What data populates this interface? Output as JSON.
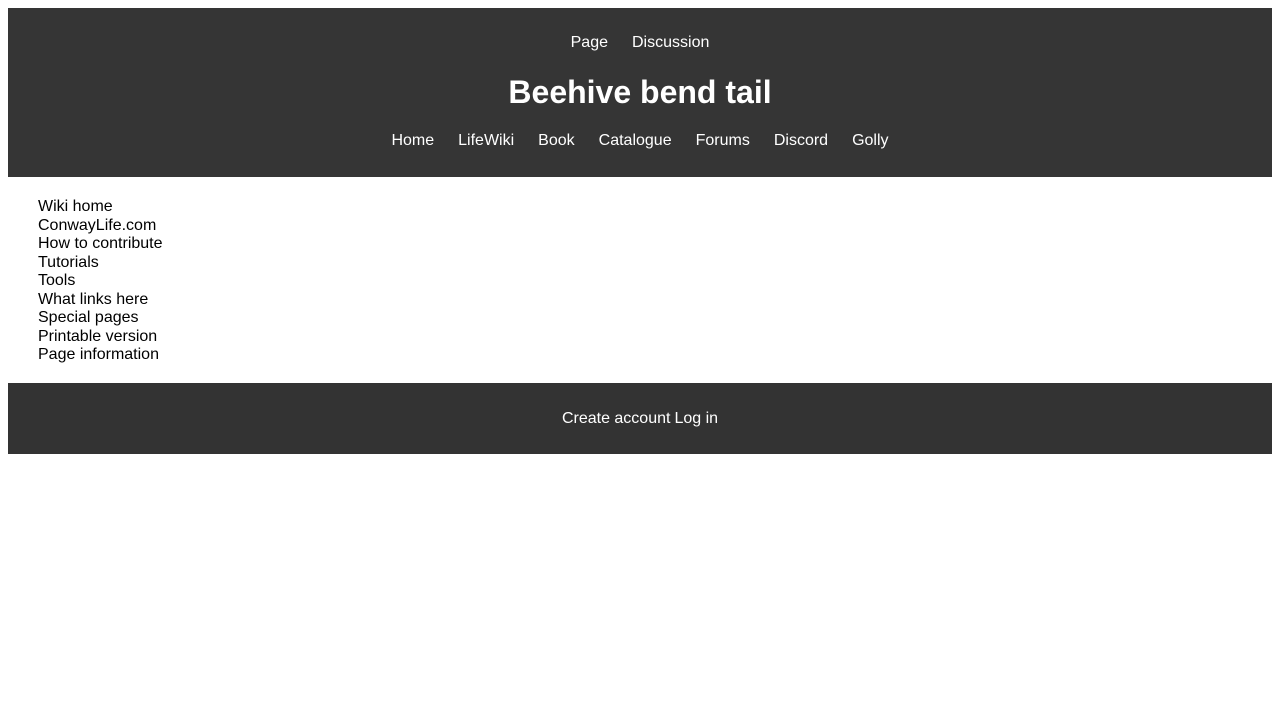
{
  "header": {
    "top_tabs": [
      "Page",
      "Discussion"
    ],
    "title": "Beehive bend tail",
    "nav": [
      "Home",
      "LifeWiki",
      "Book",
      "Catalogue",
      "Forums",
      "Discord",
      "Golly"
    ]
  },
  "sidebar": {
    "items": [
      "Wiki home",
      "ConwayLife.com",
      "How to contribute",
      "Tutorials",
      "Tools",
      "What links here",
      "Special pages",
      "Printable version",
      "Page information"
    ]
  },
  "footer": {
    "links": [
      "Create account",
      "Log in"
    ]
  },
  "colors": {
    "header_bg": "#353535",
    "footer_bg": "#333333",
    "header_text": "#ffffff",
    "body_text": "#000000"
  }
}
